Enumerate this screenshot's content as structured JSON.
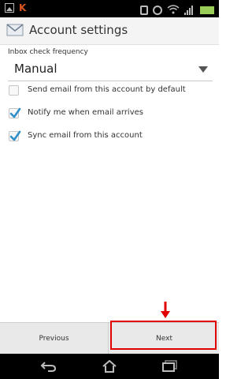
{
  "status_bar": {
    "icons": [
      "gallery-icon",
      "kaspersky-icon",
      "vibrate-icon",
      "alarm-icon",
      "wifi-icon",
      "signal-icon",
      "battery-icon"
    ]
  },
  "header": {
    "icon": "mail-icon",
    "title": "Account settings"
  },
  "inbox_check": {
    "label": "Inbox check frequency",
    "value": "Manual"
  },
  "options": [
    {
      "label": "Send email from this account by default",
      "checked": false
    },
    {
      "label": "Notify me when email arrives",
      "checked": true
    },
    {
      "label": "Sync email from this account",
      "checked": true
    }
  ],
  "buttons": {
    "previous": "Previous",
    "next": "Next"
  },
  "nav_bar": {
    "icons": [
      "back-icon",
      "home-icon",
      "recent-apps-icon"
    ]
  },
  "colors": {
    "check": "#2f8fc9",
    "highlight": "#e00000"
  }
}
